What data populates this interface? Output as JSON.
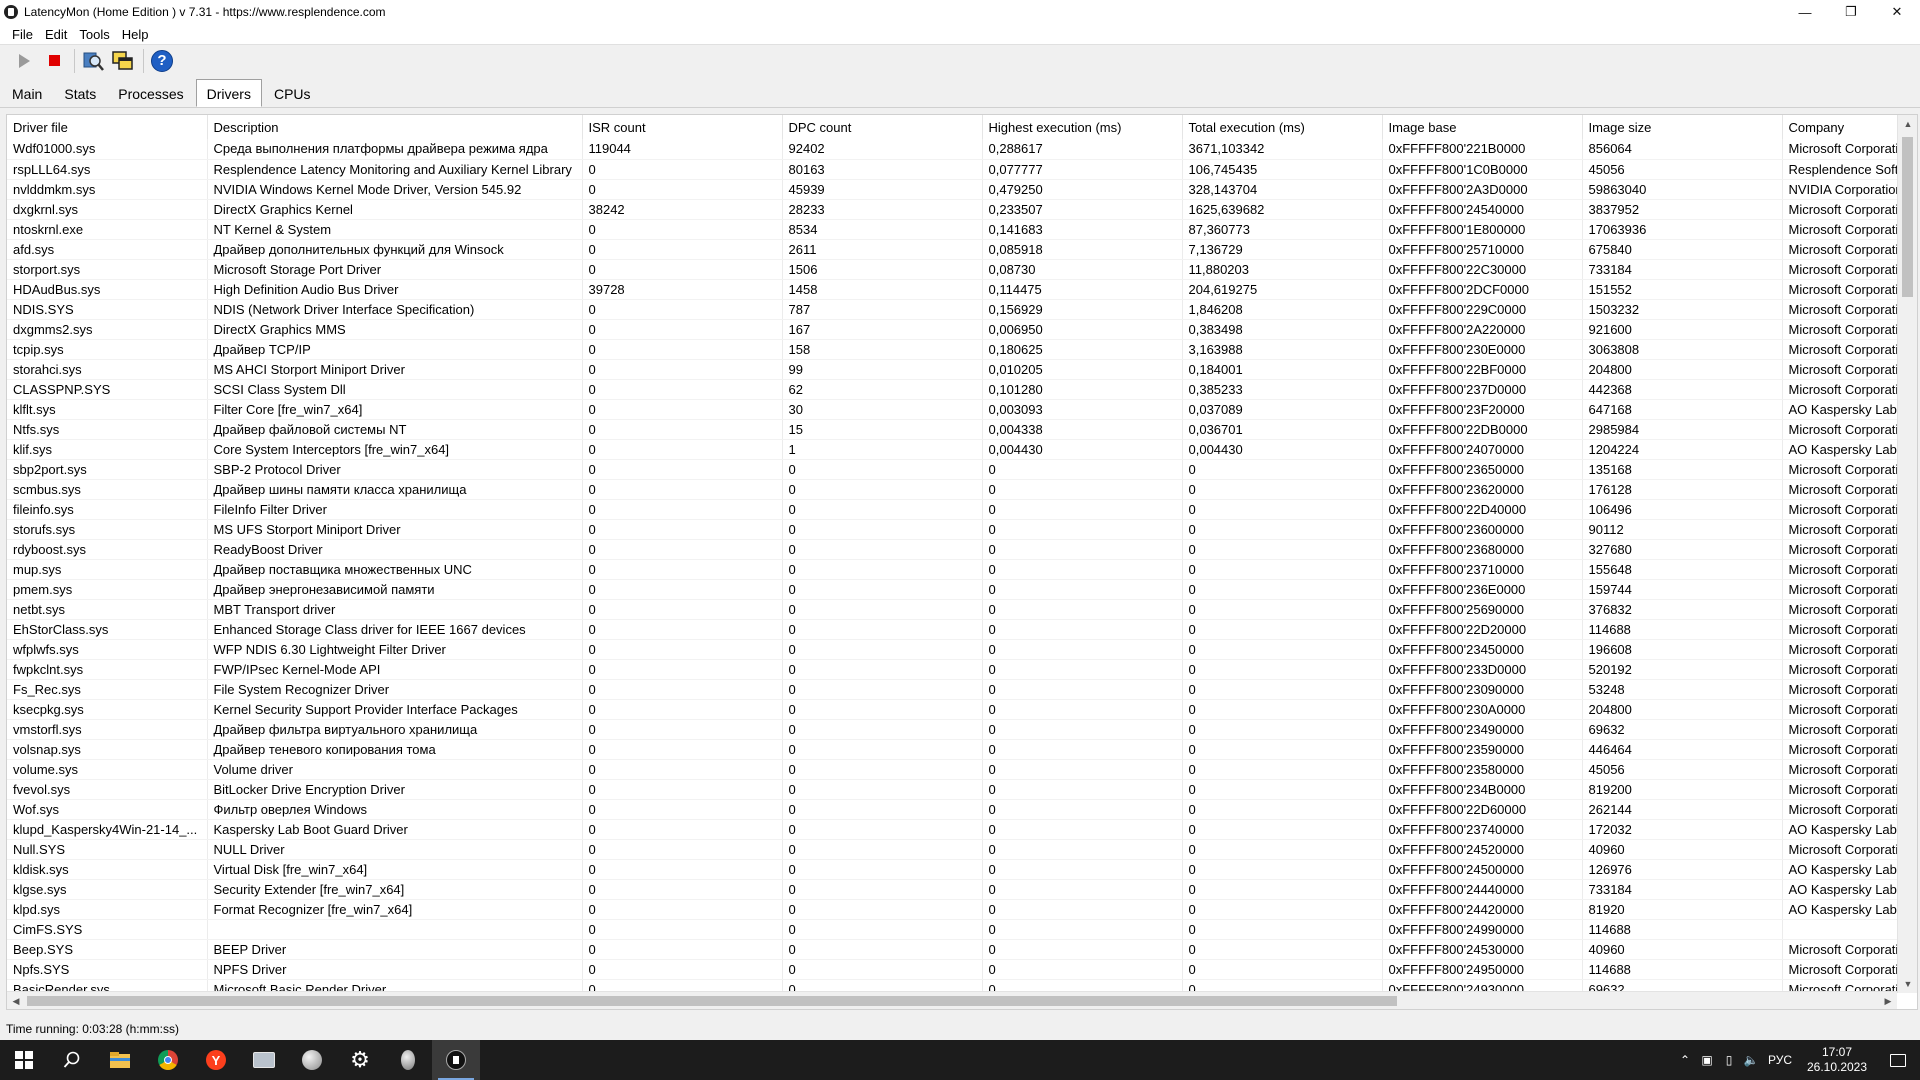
{
  "window": {
    "title": "LatencyMon  (Home Edition )  v 7.31 - https://www.resplendence.com",
    "controls": [
      "minimize-icon",
      "restore-icon",
      "close-icon"
    ]
  },
  "menu": [
    "File",
    "Edit",
    "Tools",
    "Help"
  ],
  "toolbar": {
    "buttons": [
      "play-icon",
      "stop-icon",
      "search-drivers-icon",
      "copy-windows-icon",
      "help-icon"
    ]
  },
  "tabs": [
    {
      "label": "Main",
      "active": false
    },
    {
      "label": "Stats",
      "active": false
    },
    {
      "label": "Processes",
      "active": false
    },
    {
      "label": "Drivers",
      "active": true
    },
    {
      "label": "CPUs",
      "active": false
    }
  ],
  "table": {
    "columns": [
      "Driver file",
      "Description",
      "ISR count",
      "DPC count",
      "Highest execution (ms)",
      "Total execution (ms)",
      "Image base",
      "Image size",
      "Company"
    ],
    "rows": [
      [
        "Wdf01000.sys",
        "Среда выполнения платформы драйвера режима ядра",
        "119044",
        "92402",
        "0,288617",
        "3671,103342",
        "0xFFFFF800'221B0000",
        "856064",
        "Microsoft Corporation"
      ],
      [
        "rspLLL64.sys",
        "Resplendence Latency Monitoring and Auxiliary Kernel Library",
        "0",
        "80163",
        "0,077777",
        "106,745435",
        "0xFFFFF800'1C0B0000",
        "45056",
        "Resplendence Software"
      ],
      [
        "nvlddmkm.sys",
        "NVIDIA Windows Kernel Mode Driver, Version 545.92",
        "0",
        "45939",
        "0,479250",
        "328,143704",
        "0xFFFFF800'2A3D0000",
        "59863040",
        "NVIDIA Corporation"
      ],
      [
        "dxgkrnl.sys",
        "DirectX Graphics Kernel",
        "38242",
        "28233",
        "0,233507",
        "1625,639682",
        "0xFFFFF800'24540000",
        "3837952",
        "Microsoft Corporation"
      ],
      [
        "ntoskrnl.exe",
        "NT Kernel & System",
        "0",
        "8534",
        "0,141683",
        "87,360773",
        "0xFFFFF800'1E800000",
        "17063936",
        "Microsoft Corporation"
      ],
      [
        "afd.sys",
        "Драйвер дополнительных функций для Winsock",
        "0",
        "2611",
        "0,085918",
        "7,136729",
        "0xFFFFF800'25710000",
        "675840",
        "Microsoft Corporation"
      ],
      [
        "storport.sys",
        "Microsoft Storage Port Driver",
        "0",
        "1506",
        "0,08730",
        "11,880203",
        "0xFFFFF800'22C30000",
        "733184",
        "Microsoft Corporation"
      ],
      [
        "HDAudBus.sys",
        "High Definition Audio Bus Driver",
        "39728",
        "1458",
        "0,114475",
        "204,619275",
        "0xFFFFF800'2DCF0000",
        "151552",
        "Microsoft Corporation"
      ],
      [
        "NDIS.SYS",
        "NDIS (Network Driver Interface Specification)",
        "0",
        "787",
        "0,156929",
        "1,846208",
        "0xFFFFF800'229C0000",
        "1503232",
        "Microsoft Corporation"
      ],
      [
        "dxgmms2.sys",
        "DirectX Graphics MMS",
        "0",
        "167",
        "0,006950",
        "0,383498",
        "0xFFFFF800'2A220000",
        "921600",
        "Microsoft Corporation"
      ],
      [
        "tcpip.sys",
        "Драйвер TCP/IP",
        "0",
        "158",
        "0,180625",
        "3,163988",
        "0xFFFFF800'230E0000",
        "3063808",
        "Microsoft Corporation"
      ],
      [
        "storahci.sys",
        "MS AHCI Storport Miniport Driver",
        "0",
        "99",
        "0,010205",
        "0,184001",
        "0xFFFFF800'22BF0000",
        "204800",
        "Microsoft Corporation"
      ],
      [
        "CLASSPNP.SYS",
        "SCSI Class System Dll",
        "0",
        "62",
        "0,101280",
        "0,385233",
        "0xFFFFF800'237D0000",
        "442368",
        "Microsoft Corporation"
      ],
      [
        "klflt.sys",
        "Filter Core [fre_win7_x64]",
        "0",
        "30",
        "0,003093",
        "0,037089",
        "0xFFFFF800'23F20000",
        "647168",
        "AO Kaspersky Lab"
      ],
      [
        "Ntfs.sys",
        "Драйвер файловой системы NT",
        "0",
        "15",
        "0,004338",
        "0,036701",
        "0xFFFFF800'22DB0000",
        "2985984",
        "Microsoft Corporation"
      ],
      [
        "klif.sys",
        "Core System Interceptors [fre_win7_x64]",
        "0",
        "1",
        "0,004430",
        "0,004430",
        "0xFFFFF800'24070000",
        "1204224",
        "AO Kaspersky Lab"
      ],
      [
        "sbp2port.sys",
        "SBP-2 Protocol Driver",
        "0",
        "0",
        "0",
        "0",
        "0xFFFFF800'23650000",
        "135168",
        "Microsoft Corporation"
      ],
      [
        "scmbus.sys",
        "Драйвер шины памяти класса хранилища",
        "0",
        "0",
        "0",
        "0",
        "0xFFFFF800'23620000",
        "176128",
        "Microsoft Corporation"
      ],
      [
        "fileinfo.sys",
        "FileInfo Filter Driver",
        "0",
        "0",
        "0",
        "0",
        "0xFFFFF800'22D40000",
        "106496",
        "Microsoft Corporation"
      ],
      [
        "storufs.sys",
        "MS UFS Storport Miniport Driver",
        "0",
        "0",
        "0",
        "0",
        "0xFFFFF800'23600000",
        "90112",
        "Microsoft Corporation"
      ],
      [
        "rdyboost.sys",
        "ReadyBoost Driver",
        "0",
        "0",
        "0",
        "0",
        "0xFFFFF800'23680000",
        "327680",
        "Microsoft Corporation"
      ],
      [
        "mup.sys",
        "Драйвер поставщика множественных UNC",
        "0",
        "0",
        "0",
        "0",
        "0xFFFFF800'23710000",
        "155648",
        "Microsoft Corporation"
      ],
      [
        "pmem.sys",
        "Драйвер энергонезависимой памяти",
        "0",
        "0",
        "0",
        "0",
        "0xFFFFF800'236E0000",
        "159744",
        "Microsoft Corporation"
      ],
      [
        "netbt.sys",
        "MBT Transport driver",
        "0",
        "0",
        "0",
        "0",
        "0xFFFFF800'25690000",
        "376832",
        "Microsoft Corporation"
      ],
      [
        "EhStorClass.sys",
        "Enhanced Storage Class driver for IEEE 1667 devices",
        "0",
        "0",
        "0",
        "0",
        "0xFFFFF800'22D20000",
        "114688",
        "Microsoft Corporation"
      ],
      [
        "wfplwfs.sys",
        "WFP NDIS 6.30 Lightweight Filter Driver",
        "0",
        "0",
        "0",
        "0",
        "0xFFFFF800'23450000",
        "196608",
        "Microsoft Corporation"
      ],
      [
        "fwpkclnt.sys",
        "FWP/IPsec Kernel-Mode API",
        "0",
        "0",
        "0",
        "0",
        "0xFFFFF800'233D0000",
        "520192",
        "Microsoft Corporation"
      ],
      [
        "Fs_Rec.sys",
        "File System Recognizer Driver",
        "0",
        "0",
        "0",
        "0",
        "0xFFFFF800'23090000",
        "53248",
        "Microsoft Corporation"
      ],
      [
        "ksecpkg.sys",
        "Kernel Security Support Provider Interface Packages",
        "0",
        "0",
        "0",
        "0",
        "0xFFFFF800'230A0000",
        "204800",
        "Microsoft Corporation"
      ],
      [
        "vmstorfl.sys",
        "Драйвер фильтра виртуального хранилища",
        "0",
        "0",
        "0",
        "0",
        "0xFFFFF800'23490000",
        "69632",
        "Microsoft Corporation"
      ],
      [
        "volsnap.sys",
        "Драйвер теневого копирования тома",
        "0",
        "0",
        "0",
        "0",
        "0xFFFFF800'23590000",
        "446464",
        "Microsoft Corporation"
      ],
      [
        "volume.sys",
        "Volume driver",
        "0",
        "0",
        "0",
        "0",
        "0xFFFFF800'23580000",
        "45056",
        "Microsoft Corporation"
      ],
      [
        "fvevol.sys",
        "BitLocker Drive Encryption Driver",
        "0",
        "0",
        "0",
        "0",
        "0xFFFFF800'234B0000",
        "819200",
        "Microsoft Corporation"
      ],
      [
        "Wof.sys",
        "Фильтр оверлея Windows",
        "0",
        "0",
        "0",
        "0",
        "0xFFFFF800'22D60000",
        "262144",
        "Microsoft Corporation"
      ],
      [
        "klupd_Kaspersky4Win-21-14_...",
        "Kaspersky Lab Boot Guard Driver",
        "0",
        "0",
        "0",
        "0",
        "0xFFFFF800'23740000",
        "172032",
        "AO Kaspersky Lab"
      ],
      [
        "Null.SYS",
        "NULL Driver",
        "0",
        "0",
        "0",
        "0",
        "0xFFFFF800'24520000",
        "40960",
        "Microsoft Corporation"
      ],
      [
        "kldisk.sys",
        "Virtual Disk [fre_win7_x64]",
        "0",
        "0",
        "0",
        "0",
        "0xFFFFF800'24500000",
        "126976",
        "AO Kaspersky Lab"
      ],
      [
        "klgse.sys",
        "Security Extender [fre_win7_x64]",
        "0",
        "0",
        "0",
        "0",
        "0xFFFFF800'24440000",
        "733184",
        "AO Kaspersky Lab"
      ],
      [
        "klpd.sys",
        "Format Recognizer [fre_win7_x64]",
        "0",
        "0",
        "0",
        "0",
        "0xFFFFF800'24420000",
        "81920",
        "AO Kaspersky Lab"
      ],
      [
        "CimFS.SYS",
        "",
        "0",
        "0",
        "0",
        "0",
        "0xFFFFF800'24990000",
        "114688",
        ""
      ],
      [
        "Beep.SYS",
        "BEEP Driver",
        "0",
        "0",
        "0",
        "0",
        "0xFFFFF800'24530000",
        "40960",
        "Microsoft Corporation"
      ],
      [
        "Npfs.SYS",
        "NPFS Driver",
        "0",
        "0",
        "0",
        "0",
        "0xFFFFF800'24950000",
        "114688",
        "Microsoft Corporation"
      ],
      [
        "BasicRender.sys",
        "Microsoft Basic Render Driver",
        "0",
        "0",
        "0",
        "0",
        "0xFFFFF800'24930000",
        "69632",
        "Microsoft Corporation"
      ]
    ]
  },
  "status": {
    "text": "Time running: 0:03:28  (h:mm:ss)"
  },
  "taskbar": {
    "apps": [
      "start-icon",
      "search-icon",
      "file-explorer-icon",
      "chrome-icon",
      "yandex-browser-icon",
      "app-icon-1",
      "app-icon-2",
      "settings-icon",
      "app-icon-3",
      "latencymon-icon"
    ],
    "tray": {
      "language": "РУС",
      "time": "17:07",
      "date": "26.10.2023"
    }
  },
  "colors": {
    "accent": "#1f5fc4",
    "stop": "#e00000",
    "taskbar": "#1c1c1c"
  }
}
